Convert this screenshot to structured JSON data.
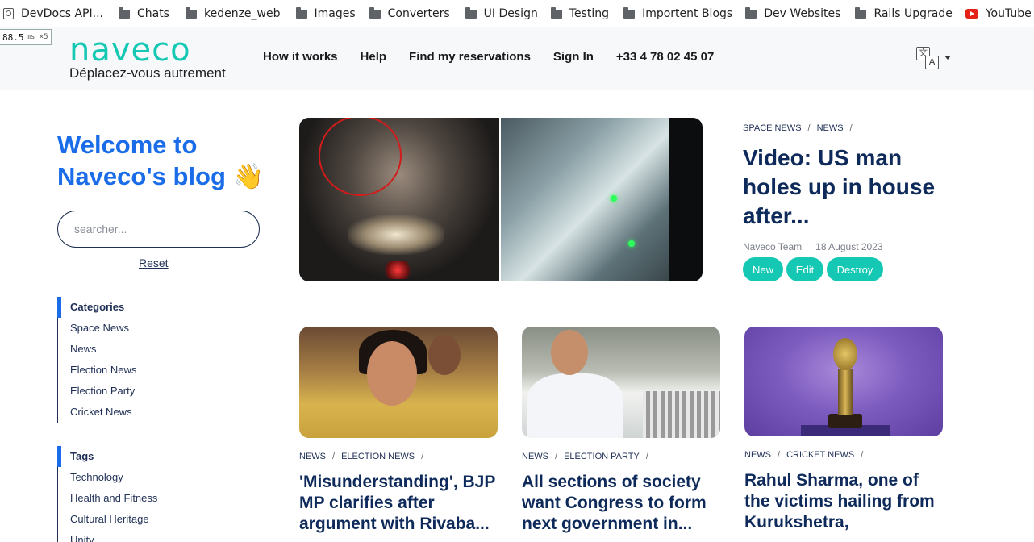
{
  "bookmarks": {
    "items": [
      {
        "label": "DevDocs API...",
        "icon": "page-search-icon"
      },
      {
        "label": "Chats",
        "icon": "folder-icon"
      },
      {
        "label": "kedenze_web",
        "icon": "folder-icon"
      },
      {
        "label": "Images",
        "icon": "folder-icon"
      },
      {
        "label": "Converters",
        "icon": "folder-icon"
      },
      {
        "label": "UI Design",
        "icon": "folder-icon"
      },
      {
        "label": "Testing",
        "icon": "folder-icon"
      },
      {
        "label": "Importent Blogs",
        "icon": "folder-icon"
      },
      {
        "label": "Dev Websites",
        "icon": "folder-icon"
      },
      {
        "label": "Rails Upgrade",
        "icon": "folder-icon"
      },
      {
        "label": "YouTube",
        "icon": "youtube-icon"
      }
    ]
  },
  "perf": {
    "value": "88.5",
    "unit": "ms ×5"
  },
  "header": {
    "logo": {
      "word": "naveco",
      "tagline": "Déplacez-vous autrement"
    },
    "nav": {
      "how_it_works": "How it works",
      "help": "Help",
      "find_reservations": "Find my reservations",
      "sign_in": "Sign In",
      "phone": "+33 4 78 02 45 07"
    },
    "language_icon": "translate-icon"
  },
  "sidebar": {
    "welcome": "Welcome to Naveco's blog 👋",
    "search": {
      "placeholder": "searcher...",
      "value": ""
    },
    "reset_label": "Reset",
    "categories": {
      "heading": "Categories",
      "items": [
        "Space News",
        "News",
        "Election News",
        "Election Party",
        "Cricket News"
      ]
    },
    "tags": {
      "heading": "Tags",
      "items": [
        "Technology",
        "Health and Fitness",
        "Cultural Heritage",
        "Unity"
      ]
    }
  },
  "featured": {
    "categories": [
      "SPACE NEWS",
      "NEWS"
    ],
    "title": "Video: US man holes up in house after...",
    "author": "Naveco Team",
    "date": "18 August 2023",
    "buttons": {
      "new": "New",
      "edit": "Edit",
      "destroy": "Destroy"
    }
  },
  "cards": [
    {
      "categories": [
        "NEWS",
        "ELECTION NEWS"
      ],
      "title": "'Misunderstanding', BJP MP clarifies after argument with Rivaba..."
    },
    {
      "categories": [
        "NEWS",
        "ELECTION PARTY"
      ],
      "title": "All sections of society want Congress to form next government in..."
    },
    {
      "categories": [
        "NEWS",
        "CRICKET NEWS"
      ],
      "title": "Rahul Sharma, one of the victims hailing from Kurukshetra,"
    }
  ],
  "colors": {
    "brand_teal": "#14c8b4",
    "accent_blue": "#1a6ce8",
    "navy": "#0e2a5a"
  }
}
